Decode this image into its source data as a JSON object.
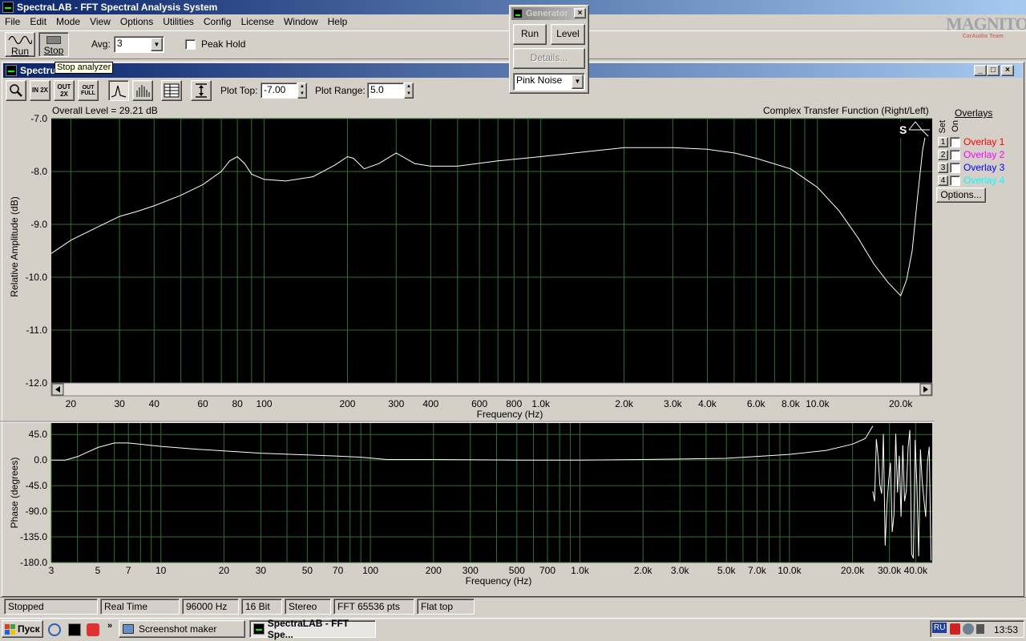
{
  "app": {
    "title": "SpectraLAB - FFT Spectral Analysis System",
    "menu": [
      "File",
      "Edit",
      "Mode",
      "View",
      "Options",
      "Utilities",
      "Config",
      "License",
      "Window",
      "Help"
    ]
  },
  "watermark": {
    "brand": "MAGNITOLA",
    "sub": "CarAudio Team"
  },
  "toolbar": {
    "run_label": "Run",
    "stop_label": "Stop",
    "tooltip": "Stop analyzer",
    "avg_label": "Avg:",
    "avg_value": "3",
    "peak_hold_label": "Peak Hold"
  },
  "generator": {
    "title": "Generator",
    "run_label": "Run",
    "level_label": "Level",
    "details_label": "Details...",
    "signal": "Pink Noise"
  },
  "spectrum": {
    "title": "Spectrum",
    "plot_top_label": "Plot Top:",
    "plot_top_value": "-7.00",
    "plot_range_label": "Plot Range:",
    "plot_range_value": "5.0",
    "overall_level": "Overall Level = 29.21 dB",
    "mode_title": "Complex Transfer Function (Right/Left)",
    "icons": [
      "zoom-icon",
      "zoom-in-2x-icon",
      "zoom-out-2x-icon",
      "zoom-full-icon",
      "line-plot-icon",
      "bar-plot-icon",
      "table-icon",
      "autoscale-icon"
    ],
    "zoom_labels": {
      "in2x": "IN 2X",
      "out2x": "OUT 2X",
      "outfull": "OUT FULL"
    }
  },
  "overlays": {
    "title": "Overlays",
    "set_label": "Set",
    "on_label": "On",
    "items": [
      {
        "num": "1",
        "label": "Overlay 1",
        "color": "#ff0000"
      },
      {
        "num": "2",
        "label": "Overlay 2",
        "color": "#ff00ff"
      },
      {
        "num": "3",
        "label": "Overlay 3",
        "color": "#0000ff"
      },
      {
        "num": "4",
        "label": "Overlay 4",
        "color": "#00ffff"
      }
    ],
    "options_label": "Options..."
  },
  "status": [
    "Stopped",
    "Real Time",
    "96000 Hz",
    "16 Bit",
    "Stereo",
    "FFT 65536 pts",
    "Flat top"
  ],
  "taskbar": {
    "start_label": "Пуск",
    "task1": "Screenshot maker",
    "task2": "SpectraLAB - FFT Spe...",
    "lang": "RU",
    "clock": "13:53"
  },
  "chart_data": [
    {
      "type": "line",
      "title": "Complex Transfer Function (Right/Left)",
      "xlabel": "Frequency (Hz)",
      "ylabel": "Relative Amplitude (dB)",
      "xscale": "log",
      "xlim": [
        17,
        26000
      ],
      "ylim": [
        -12.0,
        -7.0
      ],
      "grid": true,
      "yticks": [
        "-7.0",
        "-8.0",
        "-9.0",
        "-10.0",
        "-11.0",
        "-12.0"
      ],
      "xtick_labels": [
        "20",
        "30",
        "40",
        "60",
        "80",
        "100",
        "200",
        "300",
        "400",
        "600",
        "800",
        "1.0k",
        "2.0k",
        "3.0k",
        "4.0k",
        "6.0k",
        "8.0k",
        "10.0k",
        "20.0k"
      ],
      "series": [
        {
          "color": "#ffffff",
          "x": [
            17,
            20,
            25,
            30,
            35,
            40,
            50,
            60,
            70,
            75,
            80,
            85,
            90,
            100,
            120,
            150,
            180,
            200,
            210,
            230,
            260,
            300,
            350,
            400,
            500,
            700,
            1000,
            1500,
            2000,
            3000,
            4000,
            5000,
            6000,
            8000,
            10000,
            12000,
            14000,
            16000,
            18000,
            20000,
            21000,
            22000,
            23000,
            24000,
            25000
          ],
          "y": [
            -9.55,
            -9.3,
            -9.05,
            -8.85,
            -8.75,
            -8.65,
            -8.45,
            -8.25,
            -8.0,
            -7.8,
            -7.72,
            -7.85,
            -8.05,
            -8.15,
            -8.18,
            -8.1,
            -7.88,
            -7.72,
            -7.75,
            -7.95,
            -7.85,
            -7.65,
            -7.85,
            -7.9,
            -7.9,
            -7.8,
            -7.72,
            -7.62,
            -7.55,
            -7.55,
            -7.58,
            -7.65,
            -7.75,
            -7.95,
            -8.3,
            -8.75,
            -9.25,
            -9.75,
            -10.1,
            -10.35,
            -10.05,
            -9.5,
            -8.5,
            -7.6,
            -7.1
          ]
        }
      ]
    },
    {
      "type": "line",
      "xlabel": "Frequency (Hz)",
      "ylabel": "Phase (degrees)",
      "xscale": "log",
      "xlim": [
        3,
        48000
      ],
      "ylim": [
        -180.0,
        65.0
      ],
      "grid": true,
      "yticks": [
        "45.0",
        "0.0",
        "-45.0",
        "-90.0",
        "-135.0",
        "-180.0"
      ],
      "xtick_labels": [
        "3",
        "5",
        "7",
        "10",
        "20",
        "30",
        "50",
        "70",
        "100",
        "200",
        "300",
        "500",
        "700",
        "1.0k",
        "2.0k",
        "3.0k",
        "5.0k",
        "7.0k",
        "10.0k",
        "20.0k",
        "30.0k",
        "40.0k"
      ],
      "series": [
        {
          "color": "#ffffff",
          "x": [
            3,
            3.5,
            4,
            5,
            6,
            7,
            10,
            15,
            20,
            30,
            50,
            70,
            90,
            120,
            200,
            500,
            1000,
            2000,
            5000,
            10000,
            15000,
            20000,
            23000,
            25000
          ],
          "y": [
            0,
            0,
            6,
            22,
            30,
            30,
            24,
            19,
            16,
            12,
            9,
            7,
            5,
            1,
            1,
            0,
            0,
            1,
            3,
            10,
            17,
            28,
            38,
            60
          ]
        }
      ],
      "note_region": "noisy phase above 25 kHz"
    }
  ]
}
